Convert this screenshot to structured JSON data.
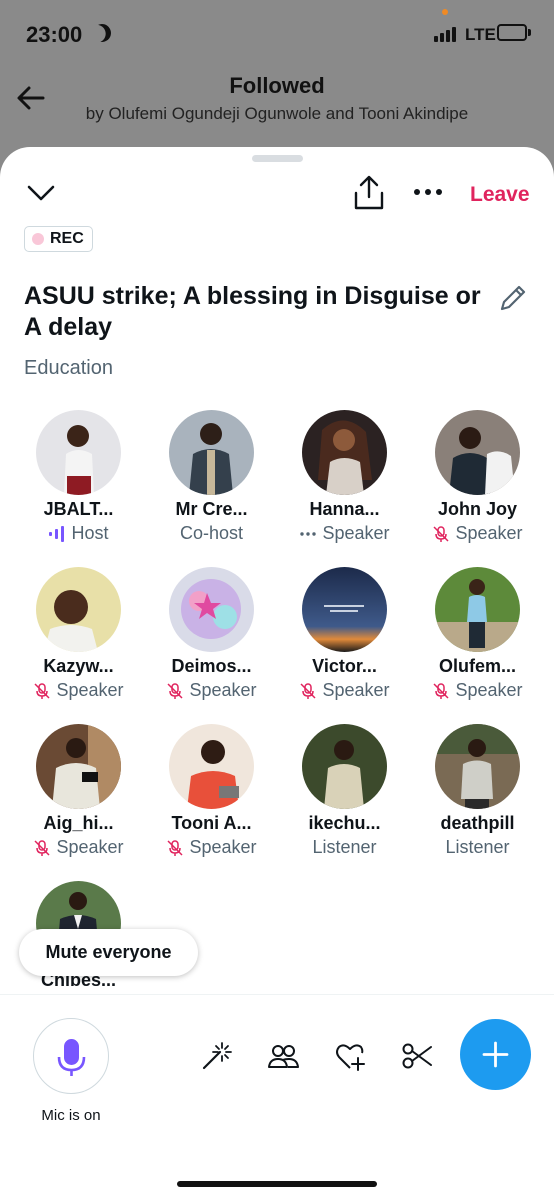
{
  "status": {
    "time": "23:00",
    "network": "LTE"
  },
  "header": {
    "title": "Followed",
    "subtitle": "by Olufemi Ogundeji Ogunwole and Tooni Akindipe"
  },
  "sheet": {
    "leave_label": "Leave",
    "rec_label": "REC",
    "space_title": "ASUU strike; A blessing in Disguise or A delay",
    "topic": "Education"
  },
  "participants": [
    {
      "name": "JBALT...",
      "role": "Host",
      "role_icon": "host-waveform-icon"
    },
    {
      "name": "Mr Cre...",
      "role": "Co-host",
      "role_icon": "none"
    },
    {
      "name": "Hanna...",
      "role": "Speaker",
      "role_icon": "speaking-dots-icon"
    },
    {
      "name": "John Joy",
      "role": "Speaker",
      "role_icon": "mic-off-icon"
    },
    {
      "name": "Kazyw...",
      "role": "Speaker",
      "role_icon": "mic-off-icon"
    },
    {
      "name": "Deimos...",
      "role": "Speaker",
      "role_icon": "mic-off-icon"
    },
    {
      "name": "Victor...",
      "role": "Speaker",
      "role_icon": "mic-off-icon"
    },
    {
      "name": "Olufem...",
      "role": "Speaker",
      "role_icon": "mic-off-icon"
    },
    {
      "name": "Aig_hi...",
      "role": "Speaker",
      "role_icon": "mic-off-icon"
    },
    {
      "name": "Tooni A...",
      "role": "Speaker",
      "role_icon": "mic-off-icon"
    },
    {
      "name": "ikechu...",
      "role": "Listener",
      "role_icon": "none"
    },
    {
      "name": "deathpill",
      "role": "Listener",
      "role_icon": "none"
    },
    {
      "name": "Chibes...",
      "role": "",
      "role_icon": "none"
    }
  ],
  "mute_everyone_label": "Mute everyone",
  "bottom_bar": {
    "mic_label": "Mic is on",
    "tools": [
      "magic-wand-icon",
      "people-icon",
      "heart-plus-icon",
      "scissors-icon"
    ],
    "fab_icon": "plus-icon"
  },
  "colors": {
    "accent": "#1d9bf0",
    "leave": "#e0245e",
    "host_purple": "#7856ff",
    "muted_pink": "#e0245e",
    "subtle": "#536471"
  }
}
